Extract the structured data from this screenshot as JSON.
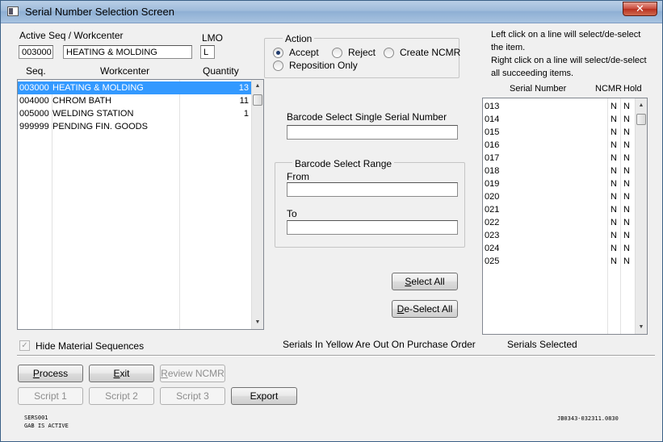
{
  "window": {
    "title": "Serial Number Selection Screen",
    "close_glyph": "✕"
  },
  "header": {
    "active_seq_label": "Active Seq / Workcenter",
    "active_seq_value": "003000",
    "active_workcenter_value": "HEATING & MOLDING",
    "lmo_label": "LMO",
    "lmo_value": "L"
  },
  "seq_list": {
    "columns": [
      "Seq.",
      "Workcenter",
      "Quantity"
    ],
    "rows": [
      {
        "seq": "003000",
        "workcenter": "HEATING & MOLDING",
        "quantity": "13",
        "selected": true
      },
      {
        "seq": "004000",
        "workcenter": "CHROM BATH",
        "quantity": "11",
        "selected": false
      },
      {
        "seq": "005000",
        "workcenter": "WELDING STATION",
        "quantity": "1",
        "selected": false
      },
      {
        "seq": "999999",
        "workcenter": "PENDING FIN. GOODS",
        "quantity": "",
        "selected": false
      }
    ]
  },
  "action": {
    "title": "Action",
    "options": [
      {
        "label": "Accept",
        "checked": true
      },
      {
        "label": "Reject",
        "checked": false
      },
      {
        "label": "Create NCMR",
        "checked": false
      },
      {
        "label": "Reposition Only",
        "checked": false
      }
    ]
  },
  "barcode": {
    "single_label": "Barcode Select Single Serial Number",
    "single_value": "",
    "range_title": "Barcode Select Range",
    "from_label": "From",
    "from_value": "",
    "to_label": "To",
    "to_value": ""
  },
  "buttons": {
    "select_all": {
      "accel": "S",
      "rest": "elect All"
    },
    "deselect_all": {
      "accel": "D",
      "rest": "e-Select All"
    },
    "process": {
      "accel": "P",
      "rest": "rocess"
    },
    "exit": {
      "accel": "E",
      "rest": "xit"
    },
    "review_ncmr": {
      "accel": "R",
      "rest": "eview NCMR"
    },
    "script1": "Script 1",
    "script2": "Script 2",
    "script3": "Script 3",
    "export": "Export"
  },
  "instructions": {
    "left_click": "Left click on a line will select/de-select the item.",
    "right_click": "Right click on a line will select/de-select all succeeding items."
  },
  "serial_list": {
    "columns": [
      "Serial Number",
      "NCMR",
      "Hold"
    ],
    "rows": [
      {
        "serial": "013",
        "ncmr": "N",
        "hold": "N"
      },
      {
        "serial": "014",
        "ncmr": "N",
        "hold": "N"
      },
      {
        "serial": "015",
        "ncmr": "N",
        "hold": "N"
      },
      {
        "serial": "016",
        "ncmr": "N",
        "hold": "N"
      },
      {
        "serial": "017",
        "ncmr": "N",
        "hold": "N"
      },
      {
        "serial": "018",
        "ncmr": "N",
        "hold": "N"
      },
      {
        "serial": "019",
        "ncmr": "N",
        "hold": "N"
      },
      {
        "serial": "020",
        "ncmr": "N",
        "hold": "N"
      },
      {
        "serial": "021",
        "ncmr": "N",
        "hold": "N"
      },
      {
        "serial": "022",
        "ncmr": "N",
        "hold": "N"
      },
      {
        "serial": "023",
        "ncmr": "N",
        "hold": "N"
      },
      {
        "serial": "024",
        "ncmr": "N",
        "hold": "N"
      },
      {
        "serial": "025",
        "ncmr": "N",
        "hold": "N"
      }
    ]
  },
  "footer": {
    "hide_material_label": "Hide Material Sequences",
    "hide_material_checked": true,
    "yellow_note": "Serials In Yellow Are Out On Purchase Order",
    "serials_selected_label": "Serials Selected",
    "program_id": "SERS001",
    "gab_status": "GAB IS ACTIVE",
    "job_id": "JB0343-032311.0830"
  },
  "colors": {
    "selection": "#3399ff",
    "titlebar": "#9fbbdb"
  }
}
